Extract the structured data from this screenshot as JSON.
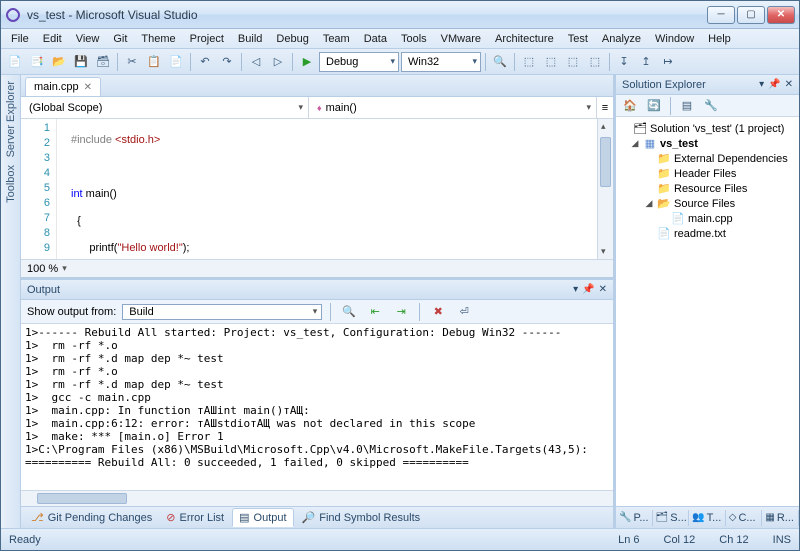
{
  "window": {
    "title": "vs_test - Microsoft Visual Studio"
  },
  "menu": [
    "File",
    "Edit",
    "View",
    "Git",
    "Theme",
    "Project",
    "Build",
    "Debug",
    "Team",
    "Data",
    "Tools",
    "VMware",
    "Architecture",
    "Test",
    "Analyze",
    "Window",
    "Help"
  ],
  "toolbar": {
    "config": "Debug",
    "platform": "Win32"
  },
  "leftRail": [
    "Server Explorer",
    "Toolbox"
  ],
  "editor": {
    "tab": "main.cpp",
    "scopeLeft": "(Global Scope)",
    "scopeRight": "main()",
    "zoom": "100 %",
    "lines": [
      "1",
      "2",
      "3",
      "4",
      "5",
      "6",
      "7",
      "8",
      "9"
    ]
  },
  "output": {
    "title": "Output",
    "showFromLabel": "Show output from:",
    "showFromValue": "Build",
    "lines": [
      "1>------ Rebuild All started: Project: vs_test, Configuration: Debug Win32 ------",
      "1>  rm -rf *.o",
      "1>  rm -rf *.d map dep *~ test",
      "1>  rm -rf *.o",
      "1>  rm -rf *.d map dep *~ test",
      "1>  gcc -c main.cpp",
      "1>  main.cpp: In function тАШint main()тАЩ:",
      "1>  main.cpp:6:12: error: тАШstdioтАЩ was not declared in this scope",
      "1>  make: *** [main.o] Error 1",
      "1>C:\\Program Files (x86)\\MSBuild\\Microsoft.Cpp\\v4.0\\Microsoft.MakeFile.Targets(43,5):",
      "========== Rebuild All: 0 succeeded, 1 failed, 0 skipped =========="
    ]
  },
  "bottomTabs": [
    "Git Pending Changes",
    "Error List",
    "Output",
    "Find Symbol Results"
  ],
  "solutionExplorer": {
    "title": "Solution Explorer",
    "root": "Solution 'vs_test' (1 project)",
    "project": "vs_test",
    "folders": [
      "External Dependencies",
      "Header Files",
      "Resource Files",
      "Source Files"
    ],
    "sourceFile": "main.cpp",
    "readme": "readme.txt"
  },
  "rightTabs": [
    "P...",
    "S...",
    "T...",
    "C...",
    "R..."
  ],
  "status": {
    "ready": "Ready",
    "ln": "Ln 6",
    "col": "Col 12",
    "ch": "Ch 12",
    "ins": "INS"
  }
}
